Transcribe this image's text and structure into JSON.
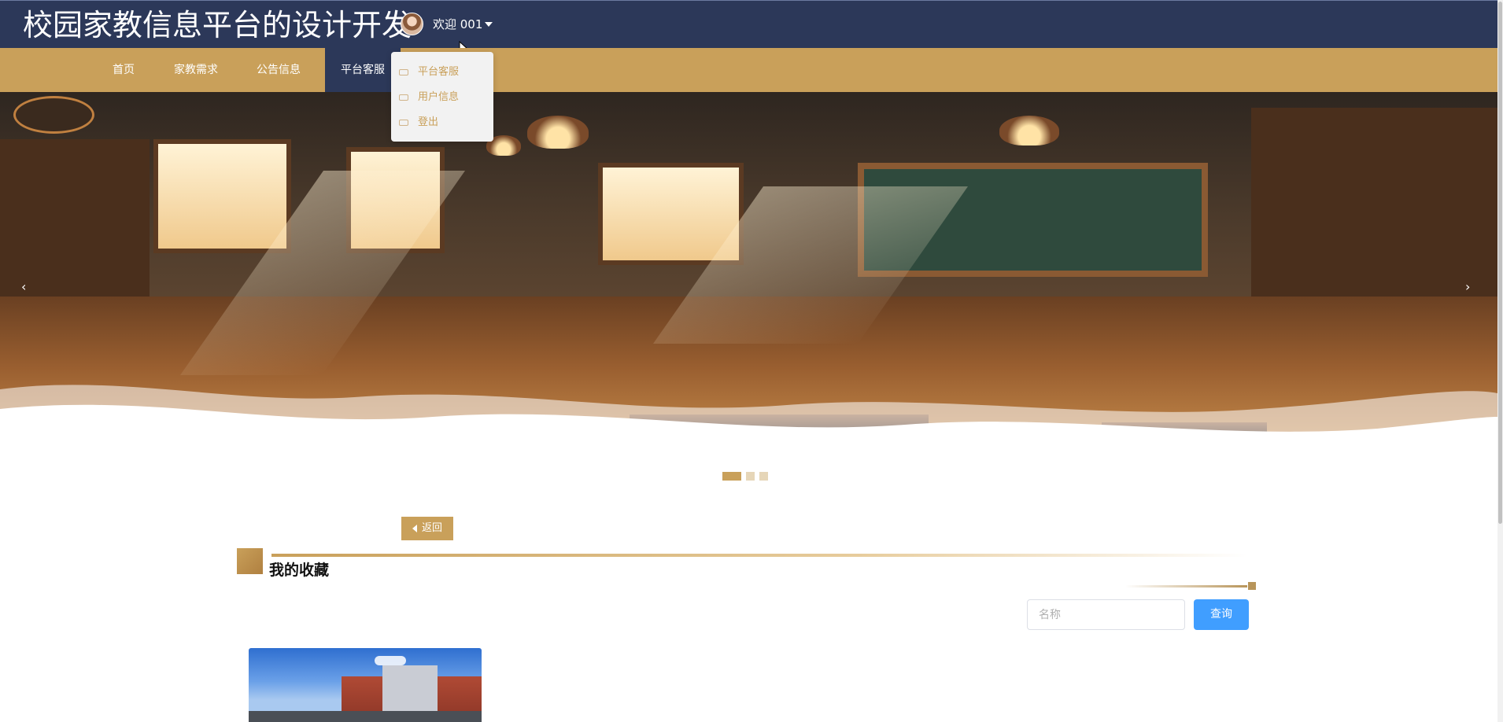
{
  "header": {
    "site_title": "校园家教信息平台的设计开发",
    "welcome_text": "欢迎 001",
    "avatar_icon": "user-avatar",
    "caret_icon": "caret-down-icon"
  },
  "nav": {
    "items": [
      {
        "label": "首页"
      },
      {
        "label": "家教需求"
      },
      {
        "label": "公告信息"
      },
      {
        "label": "平台客服"
      }
    ],
    "active_index": 3
  },
  "user_menu": {
    "items": [
      {
        "label": "平台客服",
        "icon": "truck-icon"
      },
      {
        "label": "用户信息",
        "icon": "truck-icon"
      },
      {
        "label": "登出",
        "icon": "truck-icon"
      }
    ]
  },
  "carousel": {
    "prev_icon": "‹",
    "next_icon": "›",
    "slide_count": 3,
    "active_slide": 1
  },
  "content": {
    "back_label": "返回",
    "section_title": "我的收藏",
    "search": {
      "placeholder": "名称",
      "value": ""
    },
    "search_button": "查询"
  },
  "colors": {
    "header_bg": "#2c3859",
    "nav_bg": "#c9a05a",
    "accent": "#c9a05a",
    "primary_button": "#409eff"
  }
}
